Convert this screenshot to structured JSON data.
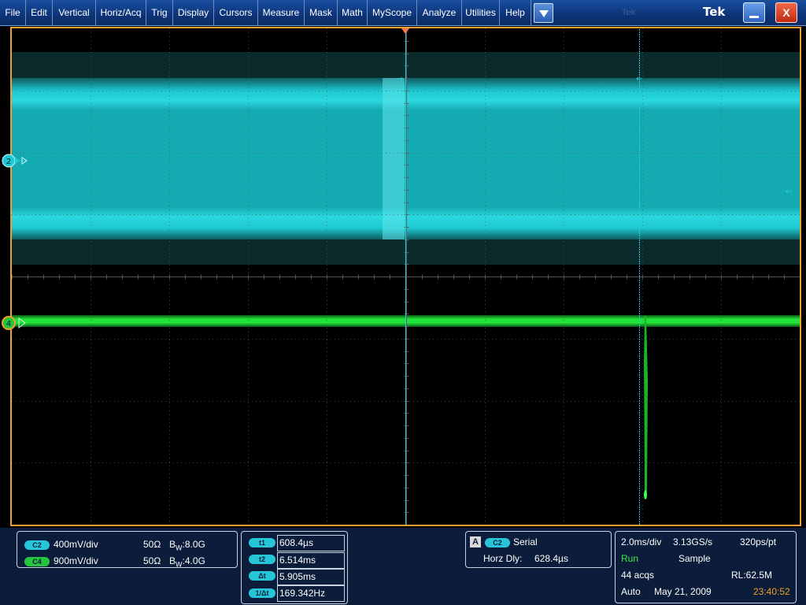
{
  "menu": {
    "items": [
      "File",
      "Edit",
      "Vertical",
      "Horiz/Acq",
      "Trig",
      "Display",
      "Cursors",
      "Measure",
      "Mask",
      "Math",
      "MyScope",
      "Analyze",
      "Utilities",
      "Help"
    ],
    "brand": "Tek",
    "ghost_text": "Tek",
    "close_label": "X"
  },
  "colors": {
    "channel2": "#1ec8d0",
    "channel4": "#22e33a",
    "frame": "#f0a030",
    "panel_bg": "#0b1d3a",
    "run": "#3ce84a",
    "clock": "#f2a024"
  },
  "channels": [
    {
      "badge": "C2",
      "scale": "400mV/div",
      "impedance": "50Ω",
      "bw_prefix": "B",
      "bw_sub": "W",
      "bw_value": ":8.0G"
    },
    {
      "badge": "C4",
      "scale": "900mV/div",
      "impedance": "50Ω",
      "bw_prefix": "B",
      "bw_sub": "W",
      "bw_value": ":4.0G"
    }
  ],
  "markers": {
    "ch2": "2",
    "ch4": "4"
  },
  "cursors": [
    {
      "label": "t1",
      "value": "608.4µs"
    },
    {
      "label": "t2",
      "value": "6.514ms"
    },
    {
      "label": "Δt",
      "value": "5.905ms"
    },
    {
      "label": "1/Δt",
      "value": "169.342Hz"
    }
  ],
  "trigger": {
    "letter": "A",
    "source": "C2",
    "type": "Serial",
    "delay_label": "Horz Dly:",
    "delay_value": "628.4µs"
  },
  "acquisition": {
    "time_div": "2.0ms/div",
    "sample_rate": "3.13GS/s",
    "resolution": "320ps/pt",
    "state": "Run",
    "mode": "Sample",
    "acqs": "44 acqs",
    "record_length": "RL:62.5M",
    "trigger_mode": "Auto",
    "date": "May 21, 2009",
    "time": "23:40:52"
  }
}
